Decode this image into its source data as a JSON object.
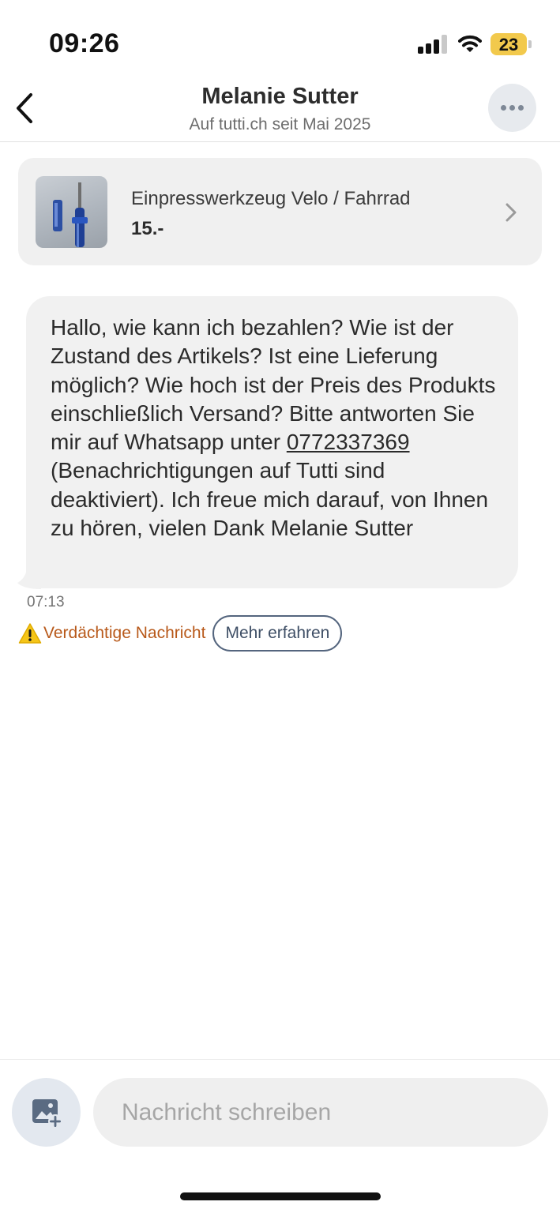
{
  "status_bar": {
    "time": "09:26",
    "battery_level": "23",
    "battery_color": "#f2c94c",
    "signal_bars_active": 3,
    "signal_bars_total": 4,
    "icons": [
      "cellular-signal-icon",
      "wifi-icon",
      "battery-icon"
    ]
  },
  "header": {
    "title": "Melanie Sutter",
    "subtitle": "Auf tutti.ch seit Mai 2025",
    "back_icon": "chevron-left-icon",
    "more_icon": "ellipsis-icon"
  },
  "listing": {
    "title": "Einpresswerkzeug Velo / Fahrrad",
    "price": "15.-",
    "thumbnail_icon": "product-photo",
    "chevron_icon": "chevron-right-icon"
  },
  "message": {
    "text_before_phone": "Hallo, wie kann ich bezahlen? Wie ist der Zustand des Artikels? Ist eine Lieferung möglich? Wie hoch ist der Preis des Produkts einschließlich Versand? Bitte antworten Sie mir auf Whatsapp unter ",
    "phone": "0772337369",
    "text_after_phone": " (Benachrichtigungen auf Tutti sind deaktiviert). Ich freue mich darauf, von Ihnen zu hören, vielen Dank Melanie Sutter",
    "time": "07:13"
  },
  "warning": {
    "label": "Verdächtige Nachricht",
    "learn_more": "Mehr erfahren",
    "icon": "warning-triangle-icon",
    "color": "#b8591a"
  },
  "composer": {
    "placeholder": "Nachricht schreiben",
    "image_icon": "add-image-icon"
  }
}
